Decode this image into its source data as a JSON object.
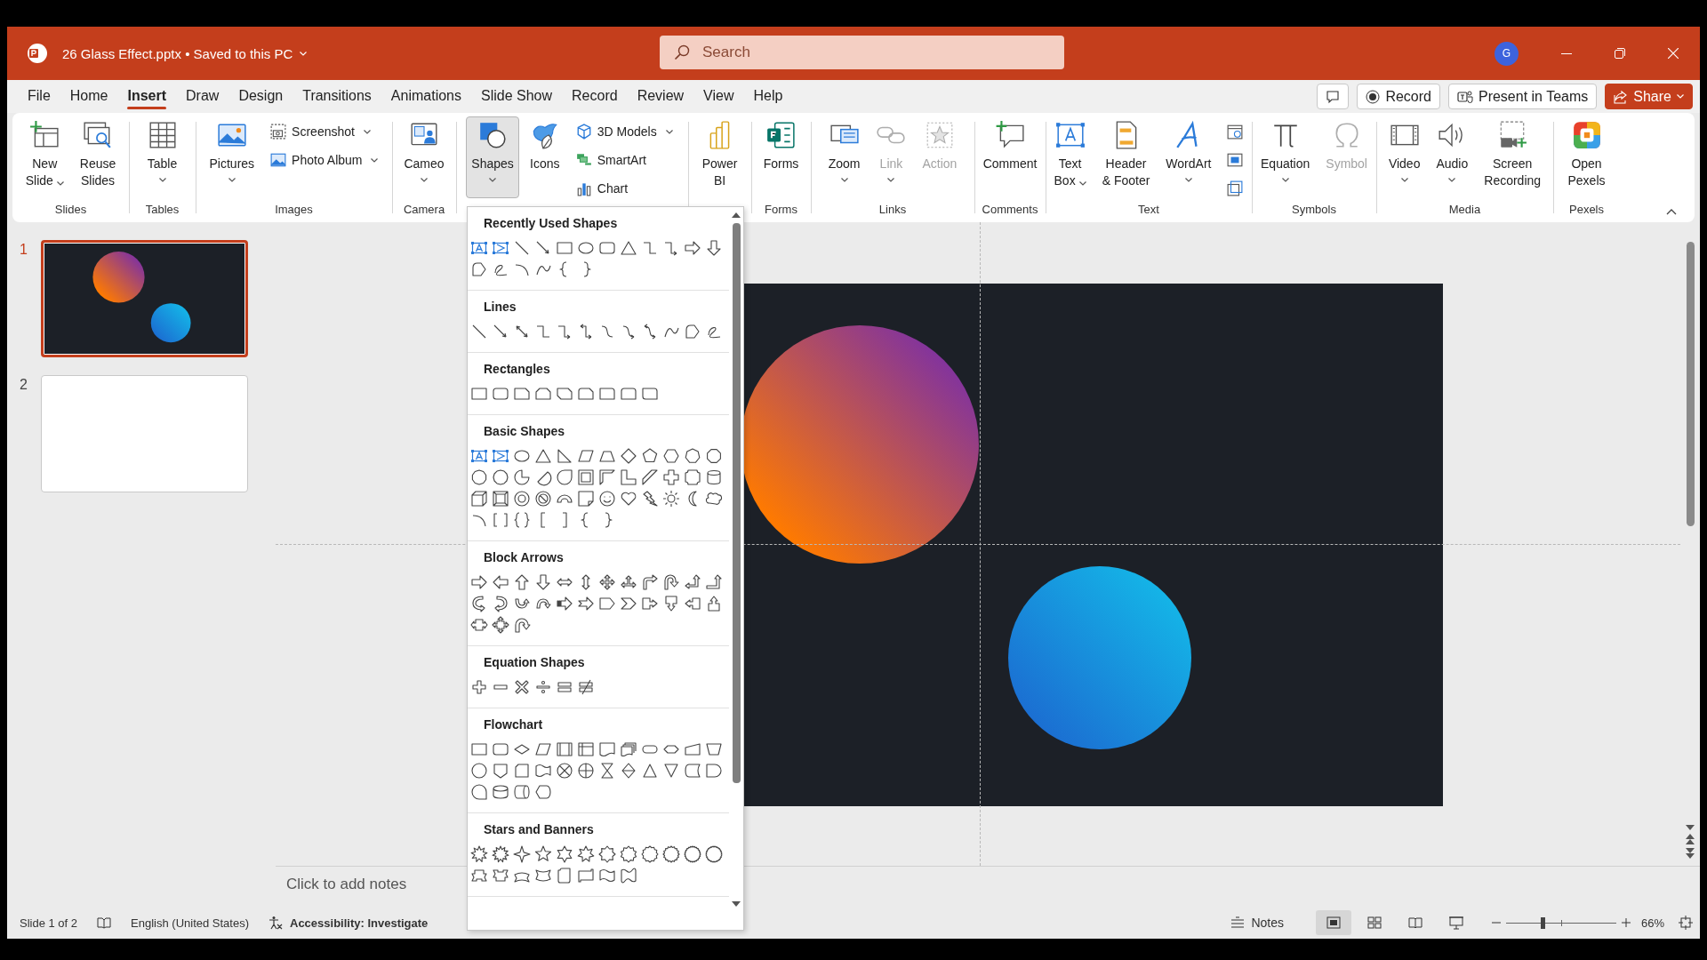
{
  "title_bar": {
    "title": "26 Glass Effect.pptx • Saved to this PC",
    "search": {
      "placeholder": "Search"
    },
    "avatar": "G"
  },
  "tabs": [
    {
      "label": "File",
      "selected": false
    },
    {
      "label": "Home",
      "selected": false
    },
    {
      "label": "Insert",
      "selected": true
    },
    {
      "label": "Draw",
      "selected": false
    },
    {
      "label": "Design",
      "selected": false
    },
    {
      "label": "Transitions",
      "selected": false
    },
    {
      "label": "Animations",
      "selected": false
    },
    {
      "label": "Slide Show",
      "selected": false
    },
    {
      "label": "Record",
      "selected": false
    },
    {
      "label": "Review",
      "selected": false
    },
    {
      "label": "View",
      "selected": false
    },
    {
      "label": "Help",
      "selected": false
    }
  ],
  "actions": [
    {
      "kind": "comments"
    },
    {
      "kind": "record",
      "label": "Record"
    },
    {
      "kind": "teams",
      "label": "Present in Teams"
    },
    {
      "kind": "share",
      "label": "Share"
    }
  ],
  "ribbon": {
    "groups": [
      {
        "label": "Slides",
        "items": [
          {
            "kind": "large",
            "label": "New\nSlide",
            "dropdown": true,
            "pressed": false,
            "disabled": false
          },
          {
            "kind": "large",
            "label": "Reuse\nSlides",
            "dropdown": false,
            "pressed": false,
            "disabled": false
          }
        ]
      },
      {
        "label": "Tables",
        "items": [
          {
            "kind": "large",
            "label": "Table",
            "dropdown": true,
            "pressed": false,
            "disabled": false
          }
        ]
      },
      {
        "label": "Images",
        "items": [
          {
            "kind": "large",
            "label": "Pictures",
            "dropdown": true,
            "pressed": false,
            "disabled": false
          },
          {
            "kind": "stack",
            "items": [
              {
                "label": "Screenshot",
                "dropdown": true,
                "pressed": false,
                "disabled": false
              },
              {
                "label": "Photo Album",
                "dropdown": true,
                "pressed": false,
                "disabled": false
              }
            ]
          }
        ]
      },
      {
        "label": "Camera",
        "items": [
          {
            "kind": "large",
            "label": "Cameo",
            "dropdown": true,
            "pressed": false,
            "disabled": false
          }
        ]
      },
      {
        "items": [
          {
            "kind": "large",
            "label": "Shapes",
            "dropdown": true,
            "pressed": true,
            "disabled": false
          },
          {
            "kind": "large",
            "label": "Icons",
            "dropdown": false,
            "pressed": false,
            "disabled": false
          },
          {
            "kind": "stack",
            "items": [
              {
                "label": "3D Models",
                "dropdown": true,
                "pressed": false,
                "disabled": false
              },
              {
                "label": "SmartArt",
                "dropdown": false,
                "pressed": false,
                "disabled": false
              },
              {
                "label": "Chart",
                "dropdown": false,
                "pressed": false,
                "disabled": false
              }
            ]
          }
        ]
      },
      {
        "items": [
          {
            "kind": "large",
            "label": "Power\nBI",
            "dropdown": false,
            "pressed": false,
            "disabled": false
          }
        ]
      },
      {
        "label": "Forms",
        "items": [
          {
            "kind": "large",
            "label": "Forms",
            "dropdown": false,
            "pressed": false,
            "disabled": false
          }
        ]
      },
      {
        "label": "Links",
        "items": [
          {
            "kind": "large",
            "label": "Zoom",
            "dropdown": true,
            "pressed": false,
            "disabled": false
          },
          {
            "kind": "large",
            "label": "Link",
            "dropdown": true,
            "pressed": false,
            "disabled": true
          },
          {
            "kind": "large",
            "label": "Action",
            "dropdown": false,
            "pressed": false,
            "disabled": true
          }
        ]
      },
      {
        "label": "Comments",
        "items": [
          {
            "kind": "large",
            "label": "Comment",
            "dropdown": false,
            "pressed": false,
            "disabled": false
          }
        ]
      },
      {
        "label": "Text",
        "items": [
          {
            "kind": "large",
            "label": "Text\nBox",
            "dropdown": true,
            "pressed": false,
            "disabled": false
          },
          {
            "kind": "large",
            "label": "Header\n& Footer",
            "dropdown": false,
            "pressed": false,
            "disabled": false
          },
          {
            "kind": "large",
            "label": "WordArt",
            "dropdown": true,
            "pressed": false,
            "disabled": false
          },
          {
            "kind": "stack",
            "items": [
              {
                "dropdown": false,
                "pressed": false,
                "disabled": false
              },
              {
                "dropdown": false,
                "pressed": false,
                "disabled": false
              },
              {
                "dropdown": false,
                "pressed": false,
                "disabled": false
              }
            ]
          }
        ]
      },
      {
        "label": "Symbols",
        "items": [
          {
            "kind": "large",
            "label": "Equation",
            "dropdown": true,
            "pressed": false,
            "disabled": false
          },
          {
            "kind": "large",
            "label": "Symbol",
            "dropdown": false,
            "pressed": false,
            "disabled": true
          }
        ]
      },
      {
        "label": "Media",
        "items": [
          {
            "kind": "large",
            "label": "Video",
            "dropdown": true,
            "pressed": false,
            "disabled": false
          },
          {
            "kind": "large",
            "label": "Audio",
            "dropdown": true,
            "pressed": false,
            "disabled": false
          },
          {
            "kind": "large",
            "label": "Screen\nRecording",
            "dropdown": false,
            "pressed": false,
            "disabled": false
          }
        ]
      },
      {
        "label": "Pexels",
        "items": [
          {
            "kind": "large",
            "label": "Open\nPexels",
            "dropdown": false,
            "pressed": false,
            "disabled": false
          }
        ]
      }
    ]
  },
  "slides": [
    {
      "number": "1",
      "selected": true,
      "has_content": true
    },
    {
      "number": "2",
      "selected": false,
      "has_content": false
    }
  ],
  "notes": {
    "placeholder": "Click to add notes"
  },
  "shapes_menu": {
    "sections": [
      {
        "title": "Recently Used Shapes"
      },
      {
        "title": "Lines"
      },
      {
        "title": "Rectangles"
      },
      {
        "title": "Basic Shapes"
      },
      {
        "title": "Block Arrows"
      },
      {
        "title": "Equation Shapes"
      },
      {
        "title": "Flowchart"
      },
      {
        "title": "Stars and Banners"
      }
    ]
  },
  "status_bar": {
    "slide_info": "Slide 1 of 2",
    "language": "English (United States)",
    "accessibility": "Accessibility: Investigate",
    "notes": "Notes",
    "views": [
      {
        "kind": "normal",
        "selected": true
      },
      {
        "kind": "sorter",
        "selected": false
      },
      {
        "kind": "reading",
        "selected": false
      },
      {
        "kind": "show",
        "selected": false
      }
    ],
    "zoom": {
      "level": 0.33,
      "reading": "66%"
    }
  }
}
